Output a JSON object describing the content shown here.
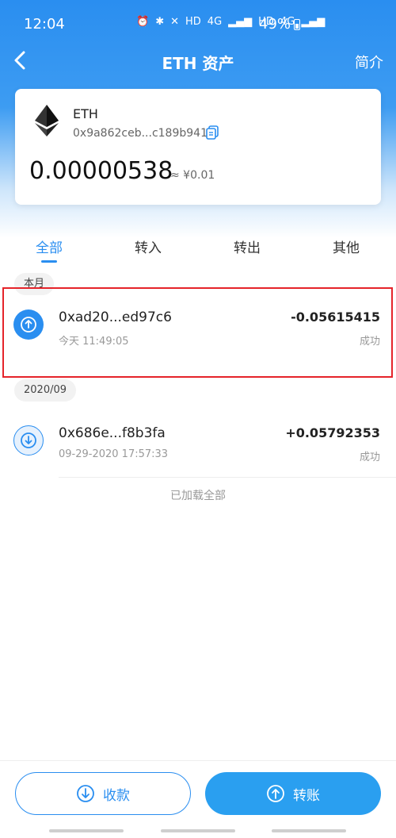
{
  "status_bar": {
    "time": "12:04",
    "battery": "49%",
    "indicators": [
      "alarm-icon",
      "bluetooth-icon",
      "mute-icon",
      "HD",
      "4G",
      "signal-icon",
      "HD",
      "4G",
      "signal-icon"
    ]
  },
  "nav": {
    "title": "ETH 资产",
    "intro_label": "简介"
  },
  "asset": {
    "token": "ETH",
    "address": "0x9a862ceb...c189b941",
    "balance": "0.00000538",
    "fiat_value": "≈ ¥0.01"
  },
  "tabs": [
    {
      "label": "全部",
      "active": true
    },
    {
      "label": "转入",
      "active": false
    },
    {
      "label": "转出",
      "active": false
    },
    {
      "label": "其他",
      "active": false
    }
  ],
  "groups": [
    {
      "month": "本月",
      "transactions": [
        {
          "hash": "0xad20...ed97c6",
          "time": "今天 11:49:05",
          "amount": "-0.05615415",
          "status": "成功",
          "direction": "out"
        }
      ]
    },
    {
      "month": "2020/09",
      "transactions": [
        {
          "hash": "0x686e...f8b3fa",
          "time": "09-29-2020 17:57:33",
          "amount": "+0.05792353",
          "status": "成功",
          "direction": "in"
        }
      ]
    }
  ],
  "footer_note": "已加载全部",
  "actions": {
    "receive_label": "收款",
    "send_label": "转账"
  },
  "colors": {
    "accent": "#2a8ef0",
    "highlight": "#e5242a"
  }
}
